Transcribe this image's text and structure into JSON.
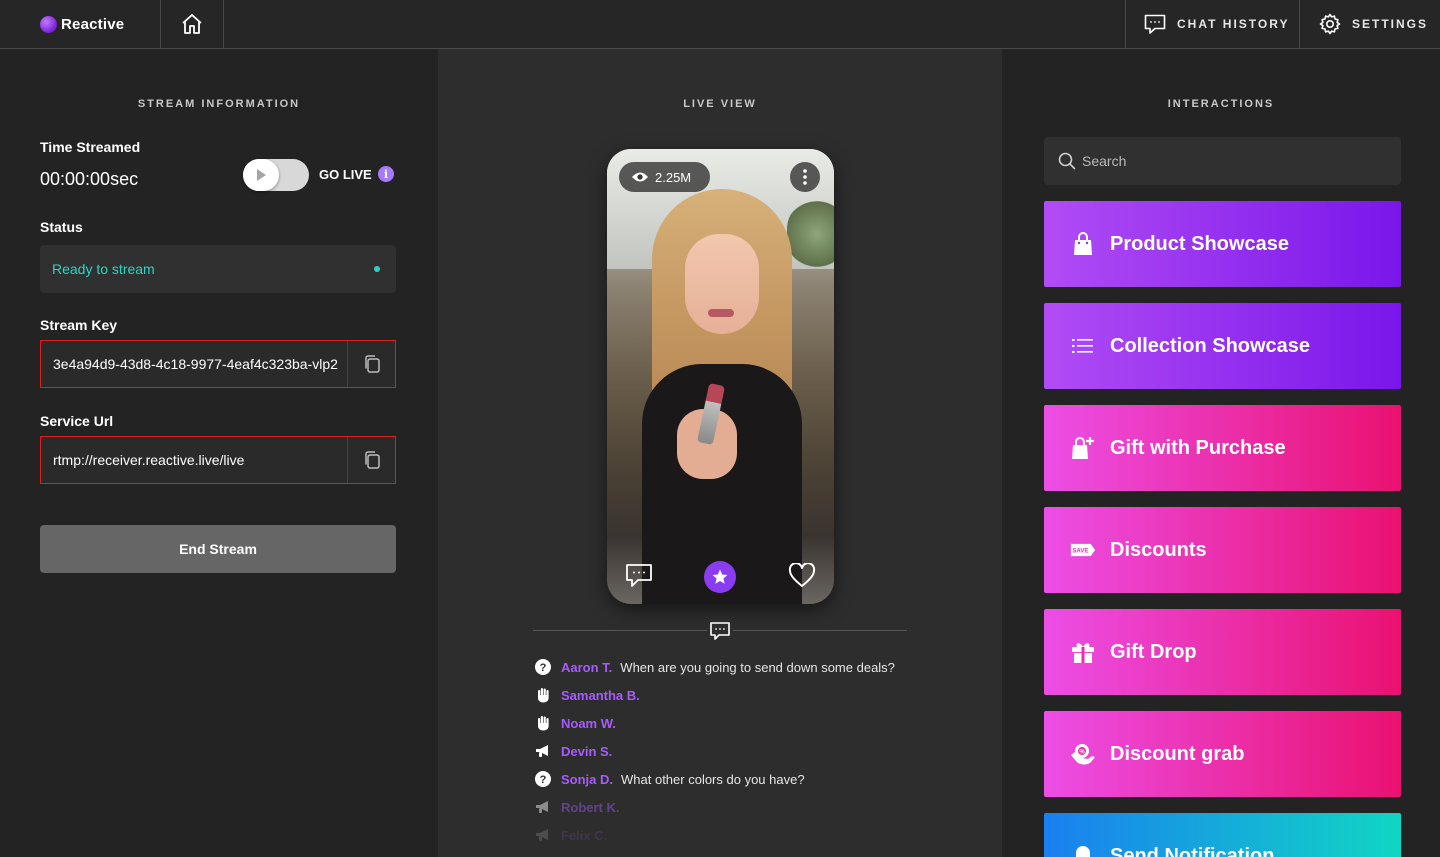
{
  "app": {
    "name": "Reactive"
  },
  "topnav": {
    "chat_history": "CHAT HISTORY",
    "settings": "SETTINGS"
  },
  "left": {
    "title": "STREAM INFORMATION",
    "time_label": "Time Streamed",
    "time_value": "00:00:00sec",
    "go_live": "GO LIVE",
    "info": "i",
    "status_label": "Status",
    "status_value": "Ready to stream",
    "key_label": "Stream Key",
    "key_value": "3e4a94d9-43d8-4c18-9977-4eaf4c323ba-vlp2",
    "url_label": "Service Url",
    "url_value": "rtmp://receiver.reactive.live/live",
    "end_stream": "End Stream"
  },
  "middle": {
    "title": "LIVE VIEW",
    "viewers": "2.25M",
    "chat": [
      {
        "icon": "question-icon",
        "name": "Aaron T.",
        "message": "When are you going to send down some deals?"
      },
      {
        "icon": "hand-icon",
        "name": "Samantha B.",
        "message": ""
      },
      {
        "icon": "hand-icon",
        "name": "Noam W.",
        "message": ""
      },
      {
        "icon": "megaphone-icon",
        "name": "Devin S.",
        "message": ""
      },
      {
        "icon": "question-icon",
        "name": "Sonja D.",
        "message": "What other colors do you have?"
      },
      {
        "icon": "megaphone-icon",
        "name": "Robert K.",
        "message": ""
      },
      {
        "icon": "megaphone-icon",
        "name": "Felix C.",
        "message": ""
      }
    ]
  },
  "right": {
    "title": "INTERACTIONS",
    "search_placeholder": "Search",
    "actions": [
      {
        "label": "Product Showcase",
        "icon": "shopping-bag-icon",
        "color": "#9a2ff0"
      },
      {
        "label": "Collection Showcase",
        "icon": "list-icon",
        "color": "#9a2ff0"
      },
      {
        "label": "Gift with Purchase",
        "icon": "gift-bag-icon",
        "color": "#ea2fa8"
      },
      {
        "label": "Discounts",
        "icon": "save-tag-icon",
        "color": "#ea2fa8"
      },
      {
        "label": "Gift Drop",
        "icon": "gift-icon",
        "color": "#ea2fa8"
      },
      {
        "label": "Discount grab",
        "icon": "discount-hand-icon",
        "color": "#ea2fa8"
      },
      {
        "label": "Send Notification",
        "icon": "bell-icon",
        "color": "#1aa7e0"
      }
    ]
  },
  "colors": {
    "accent": "#8a3cf0",
    "status": "#2dd4c4",
    "error_border": "#e01e1e"
  }
}
